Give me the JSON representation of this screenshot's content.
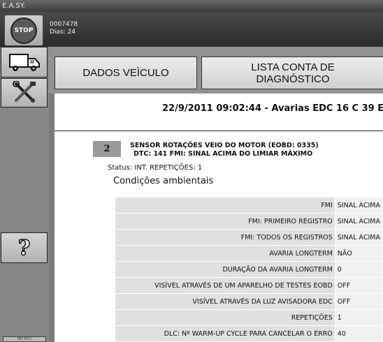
{
  "app": {
    "title": "E.A.SY."
  },
  "header": {
    "id_line": "0007478",
    "days_line": "Dias: 24"
  },
  "sidebar": {
    "stop_label": "STOP",
    "footer_label": "NO ECU"
  },
  "tabs": [
    {
      "label": "DADOS VEÌCULO"
    },
    {
      "label": "LISTA CONTA DE DIAGNÓSTICO"
    }
  ],
  "report": {
    "title": "22/9/2011 09:02:44 - Avarias EDC 16 C 39 E",
    "error_number": "2",
    "error_title": "SENSOR ROTAÇÕES VEIO DO MOTOR (EOBD: 0335)",
    "error_dtc": "DTC: 141 FMI: SINAL ACIMA DO LIMIAR MÁXIMO",
    "status": "Status: INT.  REPETIÇÕES: 1",
    "conditions_heading": "Condições ambientais",
    "params": [
      {
        "key": "FMI",
        "value": "SINAL ACIMA"
      },
      {
        "key": "FMI: PRIMEIRO REGISTRO",
        "value": "SINAL ACIMA"
      },
      {
        "key": "FMI: TODOS OS REGISTROS",
        "value": "SINAL ACIMA"
      },
      {
        "key": "AVARIA LONGTERM",
        "value": "NÃO"
      },
      {
        "key": "DURAÇÃO DA AVARIA LONGTERM",
        "value": "0"
      },
      {
        "key": "VISÍVEL ATRAVÉS DE UM APARELHO DE TESTES EOBD",
        "value": "OFF"
      },
      {
        "key": "VISÍVEL ATRAVÉS DA LUZ AVISADORA EDC",
        "value": "OFF"
      },
      {
        "key": "REPETIÇÕES",
        "value": "1"
      },
      {
        "key": "DLC: Nº WARM-UP CYCLE PARA CANCELAR O ERRO",
        "value": "40"
      }
    ]
  }
}
